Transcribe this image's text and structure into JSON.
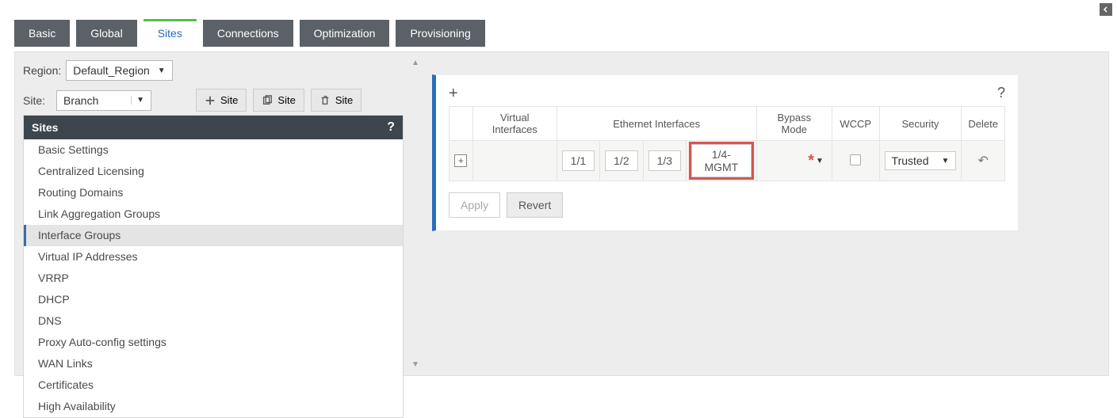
{
  "topTabs": {
    "basic": "Basic",
    "global": "Global",
    "sites": "Sites",
    "connections": "Connections",
    "optimization": "Optimization",
    "provisioning": "Provisioning"
  },
  "region": {
    "label": "Region:",
    "value": "Default_Region"
  },
  "site": {
    "label": "Site:",
    "value": "Branch",
    "addBtn": "Site",
    "cloneBtn": "Site",
    "deleteBtn": "Site"
  },
  "tree": {
    "header": "Sites",
    "help": "?",
    "items": {
      "0": "Basic Settings",
      "1": "Centralized Licensing",
      "2": "Routing Domains",
      "3": "Link Aggregation Groups",
      "4": "Interface Groups",
      "5": "Virtual IP Addresses",
      "6": "VRRP",
      "7": "DHCP",
      "8": "DNS",
      "9": "Proxy Auto-config settings",
      "10": "WAN Links",
      "11": "Certificates",
      "12": "High Availability"
    },
    "selectedIndex": 4
  },
  "gridHeaders": {
    "virtual": "Virtual Interfaces",
    "ethernet": "Ethernet Interfaces",
    "bypass": "Bypass Mode",
    "wccp": "WCCP",
    "security": "Security",
    "delete": "Delete"
  },
  "ethPorts": {
    "0": "1/1",
    "1": "1/2",
    "2": "1/3",
    "3": "1/4-MGMT"
  },
  "row": {
    "bypassRequired": "*",
    "securityValue": "Trusted"
  },
  "actions": {
    "apply": "Apply",
    "revert": "Revert",
    "help": "?"
  },
  "icons": {
    "plus": "+",
    "expand": "+",
    "dropdown": "▼",
    "undo": "↩"
  }
}
